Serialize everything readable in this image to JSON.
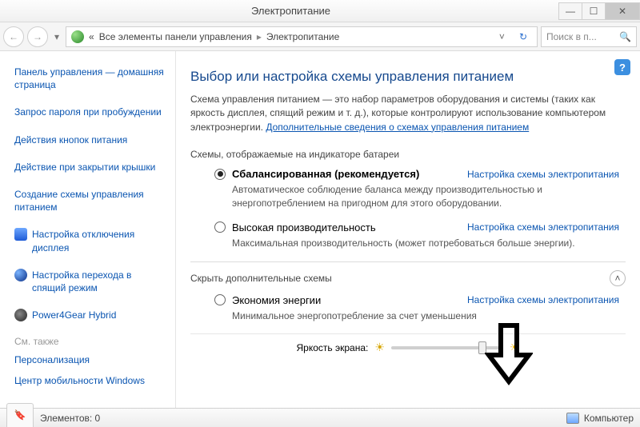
{
  "window": {
    "title": "Электропитание",
    "search_placeholder": "Поиск в п..."
  },
  "breadcrumb": {
    "prefix": "«",
    "part1": "Все элементы панели управления",
    "part2": "Электропитание"
  },
  "sidebar": {
    "home": "Панель управления — домашняя страница",
    "links": [
      "Запрос пароля при пробуждении",
      "Действия кнопок питания",
      "Действие при закрытии крышки",
      "Создание схемы управления питанием"
    ],
    "iconed": [
      {
        "label": "Настройка отключения дисплея",
        "icon": "monitor"
      },
      {
        "label": "Настройка перехода в спящий режим",
        "icon": "ball"
      },
      {
        "label": "Power4Gear Hybrid",
        "icon": "gear"
      }
    ],
    "see_also_label": "См. также",
    "see_also": [
      "Персонализация",
      "Центр мобильности Windows"
    ]
  },
  "main": {
    "title": "Выбор или настройка схемы управления питанием",
    "description_pre": "Схема управления питанием — это набор параметров оборудования и системы (таких как яркость дисплея, спящий режим и т. д.), которые контролируют использование компьютером электроэнергии. ",
    "description_link": "Дополнительные сведения о схемах управления питанием",
    "section1_label": "Схемы, отображаемые на индикаторе батареи",
    "plan_action": "Настройка схемы электропитания",
    "plans_primary": [
      {
        "name": "Сбалансированная (рекомендуется)",
        "selected": true,
        "desc": "Автоматическое соблюдение баланса между производительностью и энергопотреблением на пригодном для этого оборудовании."
      },
      {
        "name": "Высокая производительность",
        "selected": false,
        "desc": "Максимальная производительность (может потребоваться больше энергии)."
      }
    ],
    "hidden_label": "Скрыть дополнительные схемы",
    "plans_hidden": [
      {
        "name": "Экономия энергии",
        "selected": false,
        "desc": "Минимальное энергопотребление за счет уменьшения"
      }
    ],
    "brightness_label": "Яркость экрана:"
  },
  "statusbar": {
    "elements_label": "Элементов: 0",
    "computer_label": "Компьютер"
  }
}
